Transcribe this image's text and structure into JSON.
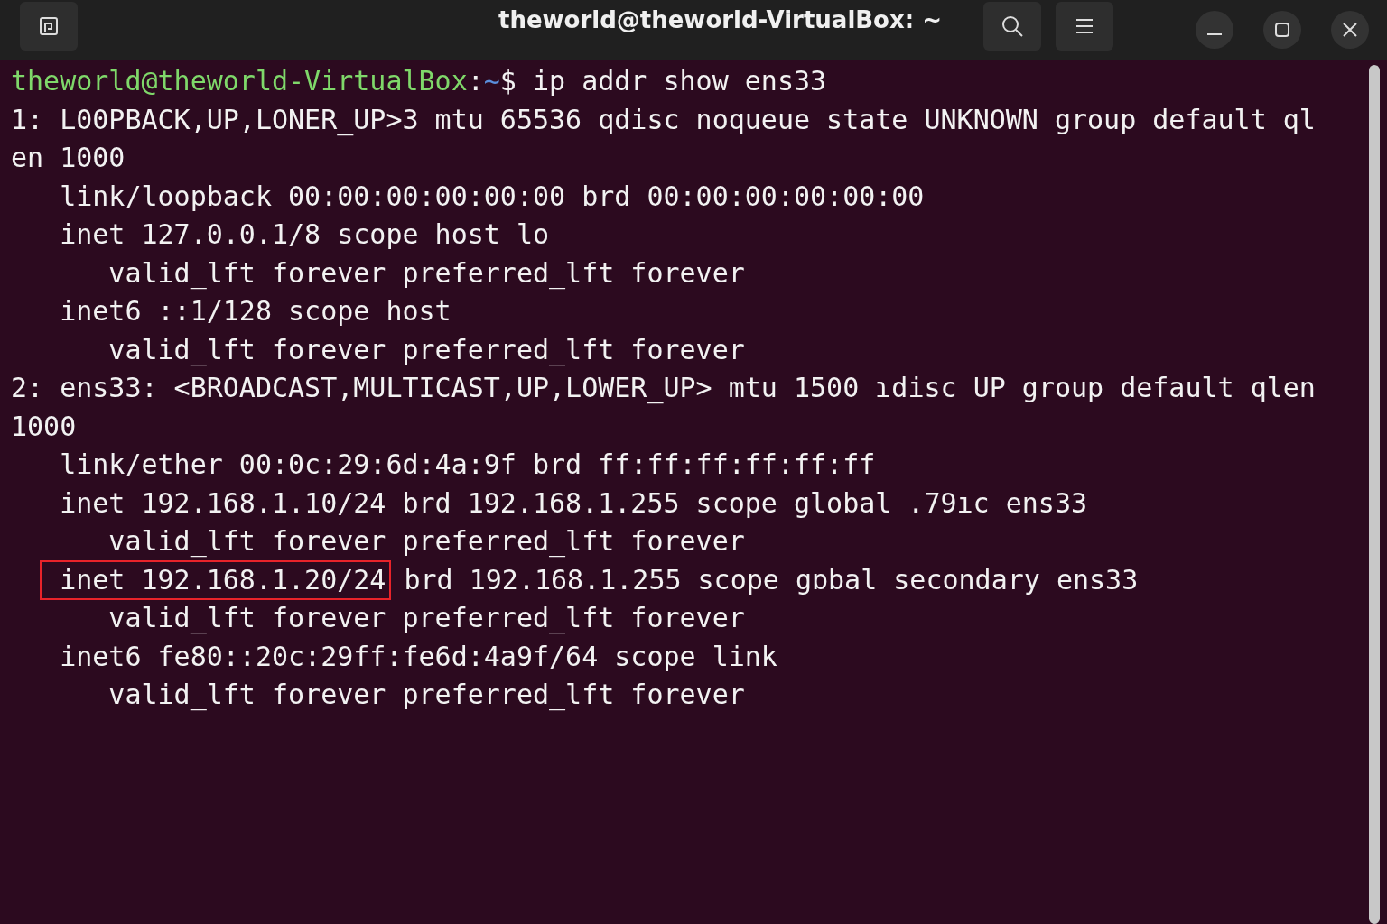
{
  "window": {
    "title": "theworld@theworld-VirtualBox: ~"
  },
  "prompt": {
    "user_host": "theworld@theworld-VirtualBox",
    "separator": ":",
    "path": "~",
    "command": "$ ip addr show ens33"
  },
  "lines": [
    {
      "kind": "header",
      "text": "1: L00PBACK,UP,LONER_UP>3 mtu 65536 qdisc noqueue state UNKNOWN group default ql"
    },
    {
      "kind": "header",
      "text": "en 1000"
    },
    {
      "kind": "address",
      "text": "link/loopback 00:00:00:00:00:00 brd 00:00:00:00:00:00"
    },
    {
      "kind": "address",
      "text": "inet 127.0.0.1/8 scope host lo"
    },
    {
      "kind": "lifetime",
      "text": "valid_lft forever preferred_lft forever"
    },
    {
      "kind": "address",
      "text": "inet6 ::1/128 scope host"
    },
    {
      "kind": "lifetime",
      "text": "valid_lft forever preferred_lft forever"
    },
    {
      "kind": "header",
      "text": "2: ens33: <BROADCAST,MULTICAST,UP,LOWER_UP> mtu 1500 ɿdisc UP group default qlen"
    },
    {
      "kind": "header",
      "text": "1000"
    },
    {
      "kind": "address",
      "text": "link/ether 00:0c:29:6d:4a:9f brd ff:ff:ff:ff:ff:ff"
    },
    {
      "kind": "address",
      "text": "inet 192.168.1.10/24 brd 192.168.1.255 scope global .79ıc ens33"
    },
    {
      "kind": "lifetime",
      "text": "valid_lft forever preferred_lft forever"
    },
    {
      "kind": "address",
      "highlight": "inet 192.168.1.20/24",
      "text": "brd 192.168.1.255 scope gɒbal secondary ens33"
    },
    {
      "kind": "lifetime",
      "text": "valid_lft forever preferred_lft forever"
    },
    {
      "kind": "address",
      "text": "inet6 fe80::20c:29ff:fe6d:4a9f/64 scope link"
    },
    {
      "kind": "lifetime",
      "text": "valid_lft forever preferred_lft forever"
    }
  ]
}
